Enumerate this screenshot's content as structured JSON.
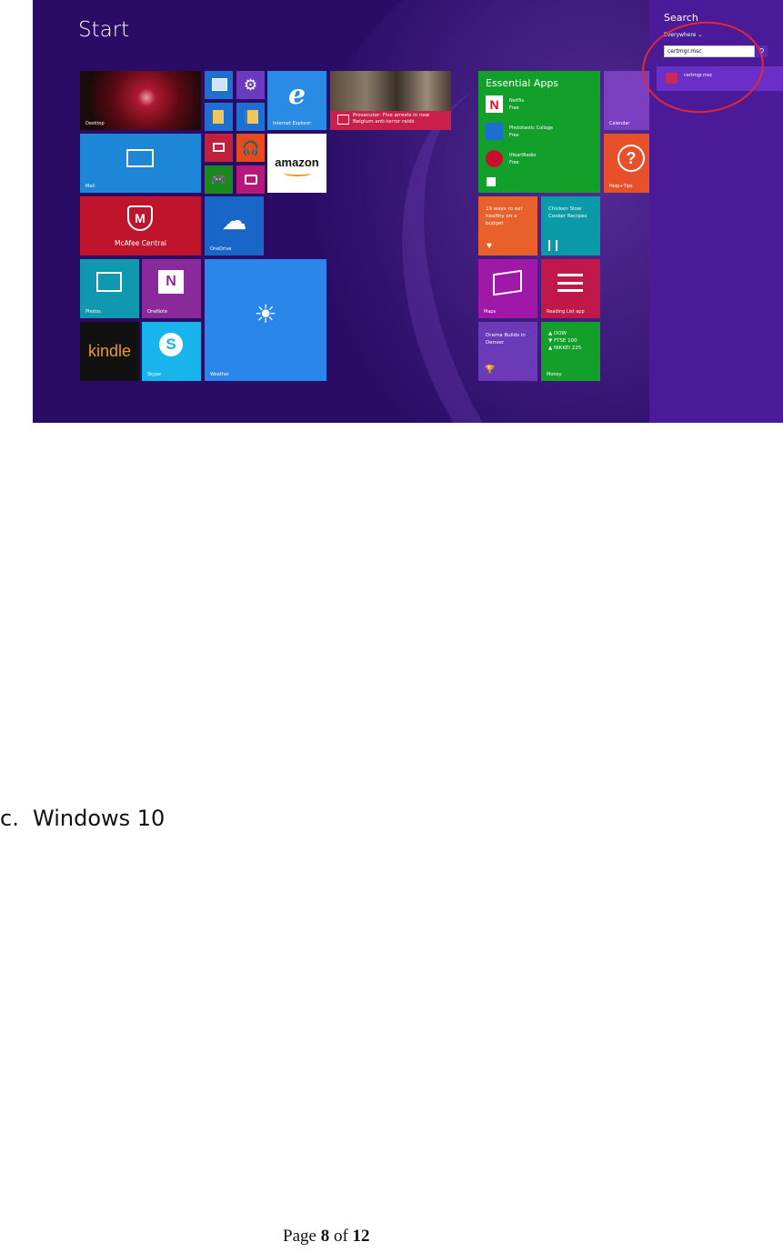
{
  "screenshot": {
    "start_title": "Start",
    "tiles": {
      "desktop": "Desktop",
      "mail": "Mail",
      "mcafee": "McAfee Central",
      "photos": "Photos",
      "onenote": "OneNote",
      "skype": "Skype",
      "kindle": "kindle",
      "onedrive": "OneDrive",
      "weather": "Weather",
      "ie": "Internet Explorer",
      "amazon": "amazon",
      "news_headline": "Prosecutor: Five arrests in new Belgium anti-terror raids",
      "essential_title": "Essential Apps",
      "netflix": "Netflix",
      "netflix_sub": "Free",
      "phototastic": "Phototastic Collage",
      "phototastic_sub": "Free",
      "iheart": "iHeartRadio",
      "iheart_sub": "Free",
      "calendar": "Calendar",
      "help": "Help+Tips",
      "health": "19 ways to eat healthy on a budget",
      "food": "Chicken Slow Cooker Recipes",
      "maps": "Maps",
      "reading": "Reading List app",
      "sports": "Drama Builds in Denver",
      "money_lines": [
        "▲ DOW",
        "▼ FTSE 100",
        "▲ NIKKEI 225"
      ],
      "money": "Money"
    },
    "search": {
      "title": "Search",
      "scope": "Everywhere ⌄",
      "query": "certmgr.msc",
      "result": "certmgr.msc"
    }
  },
  "document": {
    "item_label": "c.",
    "item_text": "Windows 10",
    "footer": {
      "page_word": "Page",
      "page_num": "8",
      "of_word": "of",
      "total": "12"
    }
  },
  "colors": {
    "start_bg": "#2a0c66",
    "search_pane": "#4a1a99",
    "highlight_circle": "#e0283a"
  }
}
